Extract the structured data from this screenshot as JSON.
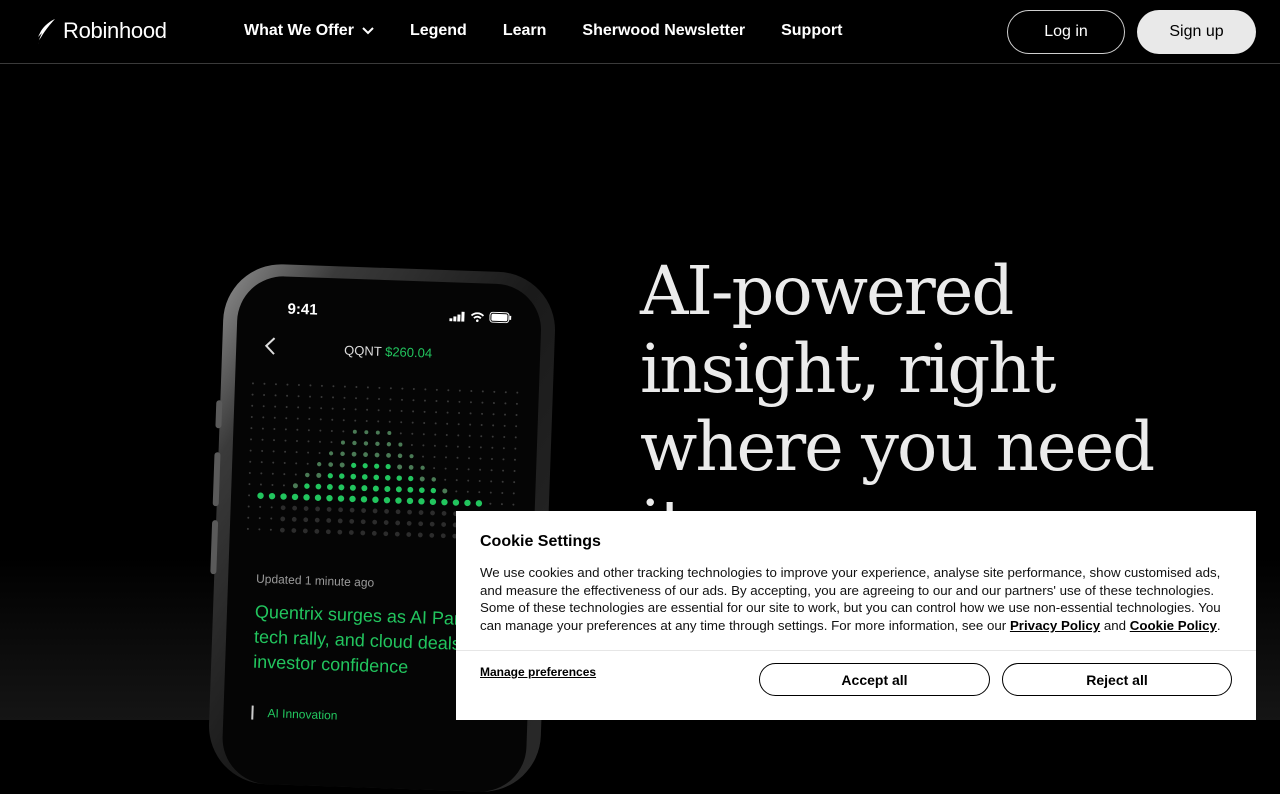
{
  "brand": {
    "name": "Robinhood"
  },
  "nav": {
    "links": [
      "What We Offer",
      "Legend",
      "Learn",
      "Sherwood Newsletter",
      "Support"
    ],
    "login_label": "Log in",
    "signup_label": "Sign up"
  },
  "hero": {
    "headline_lines": [
      "AI-powered",
      "insight, right",
      "where you need",
      "it"
    ]
  },
  "phone": {
    "time": "9:41",
    "ticker": "QQNT",
    "price": "$260.04",
    "updated": "Updated 1 minute ago",
    "headline_lines": [
      "Quentrix surges as AI Partne",
      "tech rally, and cloud deals",
      "investor confidence"
    ],
    "tag": "AI Innovation"
  },
  "cookie": {
    "title": "Cookie Settings",
    "body": "We use cookies and other tracking technologies to improve your experience, analyse site performance, show customised ads, and measure the effectiveness of our ads. By accepting, you are agreeing to our and our partners' use of these technologies. Some of these technologies are essential for our site to work, but you can control how we use non-essential technologies. You can manage your preferences at any time through settings. For more information, see our",
    "privacy_link": "Privacy Policy",
    "conjunction": "and",
    "cookie_link": "Cookie Policy",
    "period": ".",
    "manage_label": "Manage preferences",
    "accept_label": "Accept all",
    "reject_label": "Reject all"
  },
  "colors": {
    "accent_green": "#22c55e",
    "background": "#000000",
    "signup_bg": "#e9e9e9"
  }
}
